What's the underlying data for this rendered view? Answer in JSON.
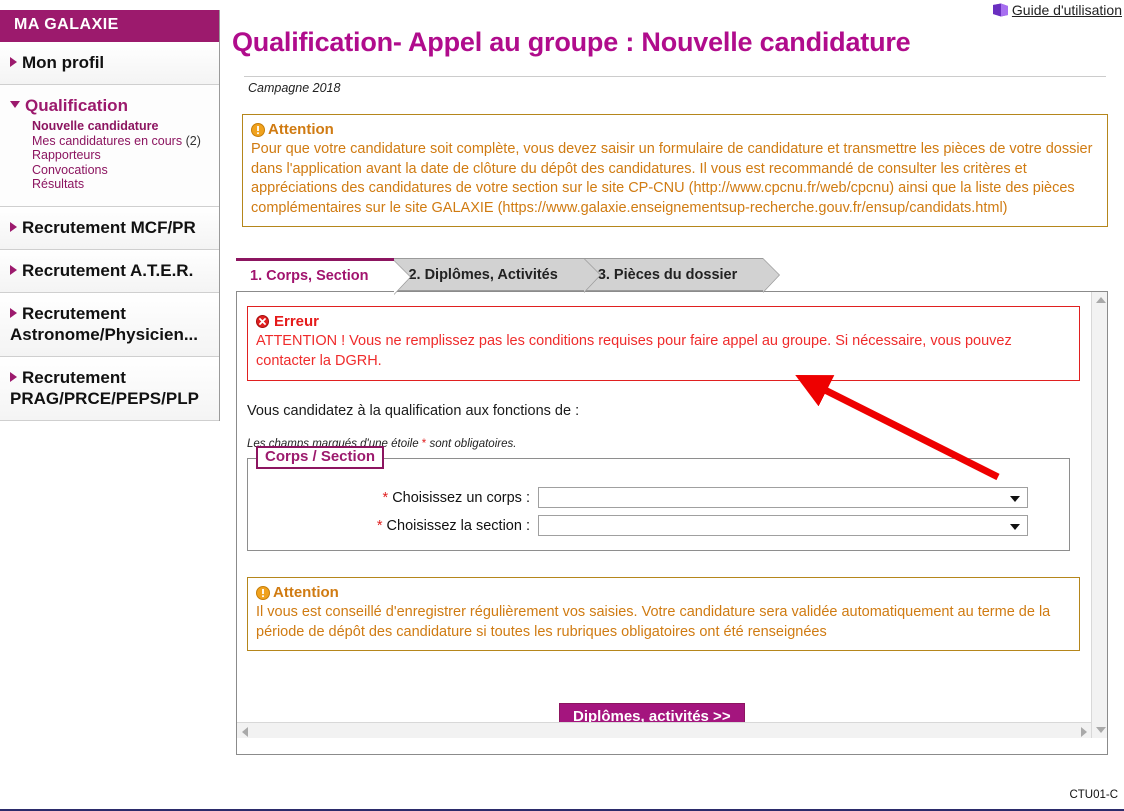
{
  "sidebar": {
    "header": "MA GALAXIE",
    "items": [
      {
        "label": "Mon profil",
        "state": "collapsed",
        "icon": "triangle-right-icon",
        "children": []
      },
      {
        "label": "Qualification",
        "state": "expanded",
        "icon": "triangle-down-icon",
        "children": [
          {
            "label": "Nouvelle candidature",
            "selected": true
          },
          {
            "label": "Mes candidatures en cours",
            "count": "(2)",
            "selected": false
          },
          {
            "label": "Rapporteurs",
            "selected": false
          },
          {
            "label": "Convocations",
            "selected": false
          },
          {
            "label": "Résultats",
            "selected": false
          }
        ]
      },
      {
        "label": "Recrutement MCF/PR",
        "state": "collapsed",
        "icon": "triangle-right-icon",
        "children": []
      },
      {
        "label": "Recrutement A.T.E.R.",
        "state": "collapsed",
        "icon": "triangle-right-icon",
        "children": []
      },
      {
        "label": "Recrutement Astronome/Physicien...",
        "state": "collapsed",
        "icon": "triangle-right-icon",
        "children": []
      },
      {
        "label": "Recrutement PRAG/PRCE/PEPS/PLP",
        "state": "collapsed",
        "icon": "triangle-right-icon",
        "children": []
      }
    ]
  },
  "header": {
    "guide_label": "Guide d'utilisation",
    "guide_icon": "book-icon",
    "title": "Qualification- Appel au groupe : Nouvelle candidature",
    "campagne": "Campagne 2018"
  },
  "attention_top": {
    "icon": "warning-icon",
    "title": "Attention",
    "body": "Pour que votre candidature soit complète, vous devez saisir un formulaire de candidature et transmettre les pièces de votre dossier dans l'application avant la date de clôture du dépôt des candidatures. Il vous est recommandé de consulter les critères et appréciations des candidatures de votre section sur le site CP-CNU (http://www.cpcnu.fr/web/cpcnu) ainsi que la liste des pièces complémentaires sur le site GALAXIE (https://www.galaxie.enseignementsup-recherche.gouv.fr/ensup/candidats.html)"
  },
  "tabs": [
    {
      "label": "1. Corps, Section",
      "active": true
    },
    {
      "label": "2. Diplômes, Activités",
      "active": false
    },
    {
      "label": "3. Pièces du dossier",
      "active": false
    }
  ],
  "error": {
    "icon": "error-icon",
    "title": "Erreur",
    "body": "ATTENTION ! Vous ne remplissez pas les conditions requises pour faire appel au groupe. Si nécessaire, vous pouvez contacter la DGRH."
  },
  "form": {
    "lead": "Vous candidatez à la qualification aux fonctions de :",
    "required_note_before": "Les champs marqués d'une étoile ",
    "required_note_star": "*",
    "required_note_after": " sont obligatoires.",
    "legend": "Corps / Section",
    "fields": [
      {
        "star": "*",
        "label": "Choisissez un corps :",
        "value": "",
        "options": []
      },
      {
        "star": "*",
        "label": "Choisissez la section :",
        "value": "",
        "options": []
      }
    ]
  },
  "attention_bottom": {
    "icon": "warning-icon",
    "title": "Attention",
    "body": "Il vous est conseillé d'enregistrer régulièrement vos saisies. Votre candidature sera validée automatiquement au terme de la période de dépôt des candidature si toutes les rubriques obligatoires ont été renseignées"
  },
  "next_button": {
    "label": "Diplômes, activités >>"
  },
  "annotation": {
    "type": "red-arrow",
    "color": "#ee0000"
  },
  "footer": {
    "code": "CTU01-C"
  },
  "colors": {
    "brand_magenta": "#9C1A6D",
    "title_magenta": "#b00c8c",
    "warning_orange": "#d07b12",
    "error_red": "#ef2b2b",
    "annotation_red": "#ee0000"
  }
}
